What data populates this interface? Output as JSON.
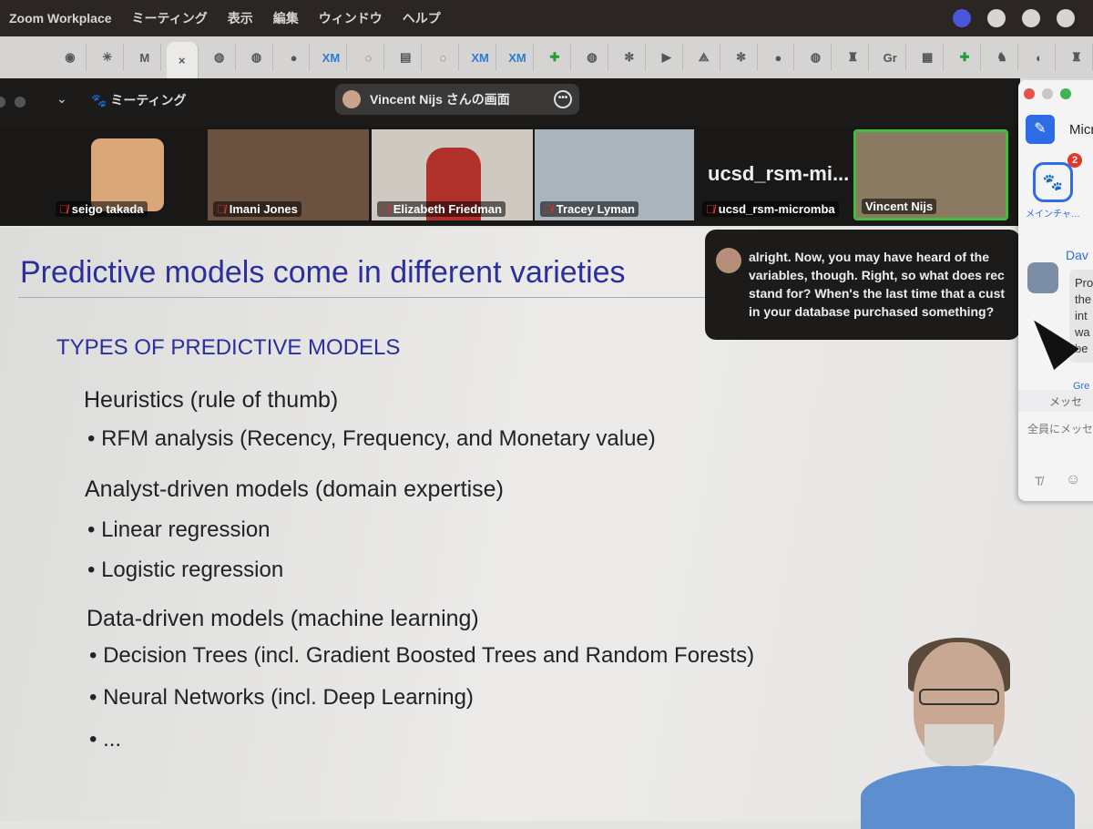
{
  "menubar": {
    "app": "Zoom Workplace",
    "items": [
      "ミーティング",
      "表示",
      "編集",
      "ウィンドウ",
      "ヘルプ"
    ]
  },
  "browser_tabs": [
    "◉",
    "✳",
    "M",
    "×",
    "◍",
    "◍",
    "●",
    "XM",
    "◌",
    "▤",
    "◌",
    "XM",
    "XM",
    "✚",
    "◍",
    "✼",
    "▶",
    "⟁",
    "✼",
    "●",
    "◍",
    "♜",
    "Gr",
    "▦",
    "✚",
    "♞",
    "◐",
    "♜"
  ],
  "zoom_header": {
    "meeting_label": "ミーティング",
    "share_label": "Vincent Nijs さんの画面"
  },
  "participants": [
    {
      "name": "seigo takada",
      "muted": true
    },
    {
      "name": "Imani Jones",
      "muted": true
    },
    {
      "name": "Elizabeth Friedman",
      "muted": true
    },
    {
      "name": "Tracey Lyman",
      "muted": true
    },
    {
      "name": "ucsd_rsm-micromba",
      "display": "ucsd_rsm-mi...",
      "muted": true
    },
    {
      "name": "Vincent Nijs",
      "muted": false,
      "active_speaker": true
    }
  ],
  "caption": {
    "lines": [
      "alright. Now, you may have heard of the",
      "variables, though. Right, so what does rec",
      "stand for? When's the last time that a cust",
      "in your database purchased something?"
    ]
  },
  "chat_panel": {
    "title": "Micr",
    "channel_label": "メインチャ…",
    "badge": "2",
    "sender": "Dav",
    "message": "Pro the int wa be",
    "next_sender": "Gre",
    "member_bar": "メッセ",
    "input_placeholder": "全員にメッセ"
  },
  "slide": {
    "title": "Predictive models come in different varieties",
    "subtitle": "TYPES OF PREDICTIVE MODELS",
    "sections": [
      {
        "heading": "Heuristics (rule of thumb)",
        "bullets": [
          "RFM analysis (Recency, Frequency, and Monetary value)"
        ]
      },
      {
        "heading": "Analyst-driven models (domain expertise)",
        "bullets": [
          "Linear regression",
          "Logistic regression"
        ]
      },
      {
        "heading": "Data-driven models (machine learning)",
        "bullets": [
          "Decision Trees (incl. Gradient Boosted Trees and Random Forests)",
          "Neural Networks (incl. Deep Learning)",
          "..."
        ]
      }
    ]
  },
  "colors": {
    "slide_title": "#2b2f9e",
    "active_speaker_border": "#3fbf3a",
    "zoom_blue": "#2e6be6",
    "mute_red": "#e02b2b"
  }
}
